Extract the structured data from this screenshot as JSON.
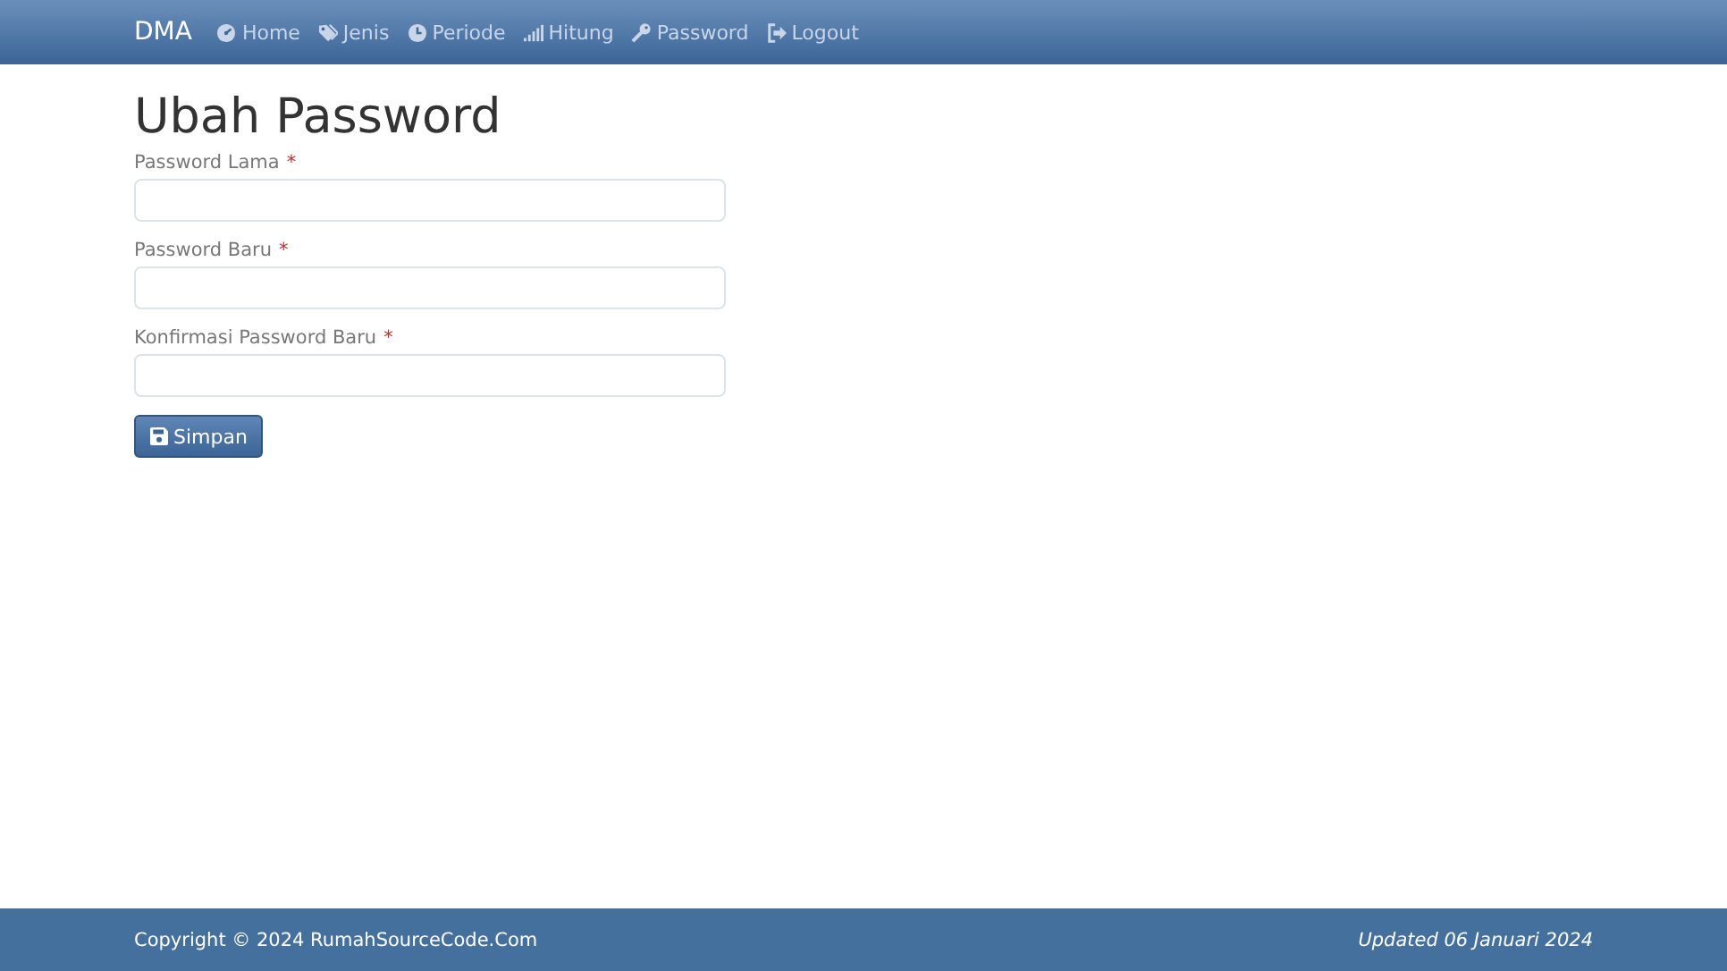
{
  "navbar": {
    "brand": "DMA",
    "items": [
      {
        "label": "Home",
        "selected": false
      },
      {
        "label": "Jenis",
        "selected": false
      },
      {
        "label": "Periode",
        "selected": false
      },
      {
        "label": "Hitung",
        "selected": false
      },
      {
        "label": "Password",
        "selected": false
      },
      {
        "label": "Logout",
        "selected": false
      }
    ]
  },
  "page": {
    "title": "Ubah Password",
    "fields": [
      {
        "label": "Password Lama",
        "required_mark": "*"
      },
      {
        "label": "Password Baru",
        "required_mark": "*"
      },
      {
        "label": "Konfirmasi Password Baru",
        "required_mark": "*"
      }
    ],
    "button": "Simpan"
  },
  "footer": {
    "copyright": "Copyright © 2024 RumahSourceCode.Com",
    "updated": "Updated 06 Januari 2024"
  }
}
